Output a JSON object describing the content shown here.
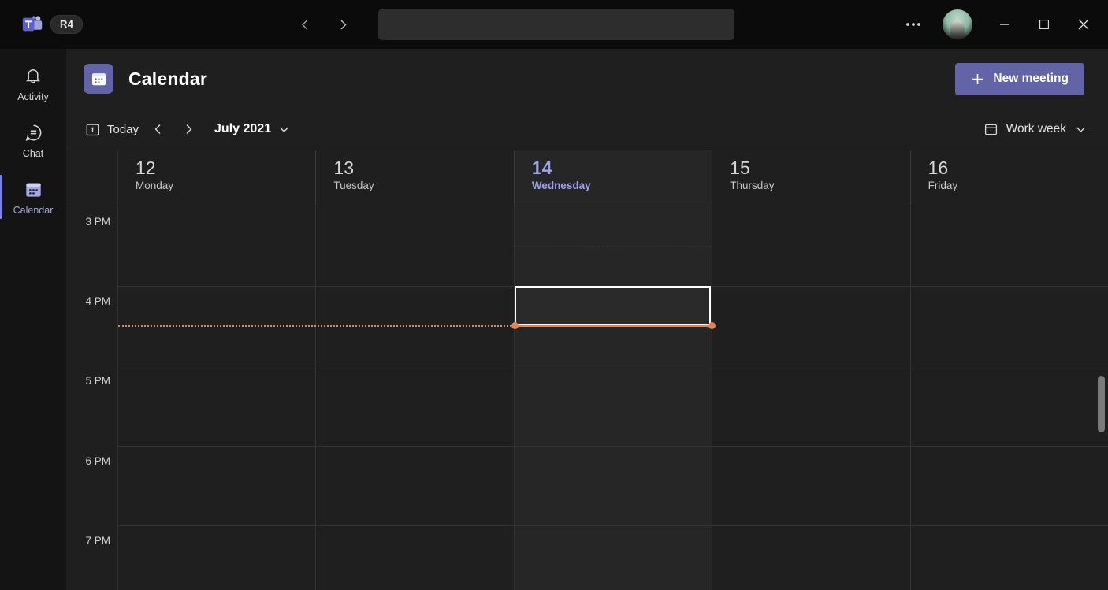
{
  "titlebar": {
    "app_badge": "R4",
    "logo_icon": "teams-logo",
    "back_icon": "chevron-left-icon",
    "forward_icon": "chevron-right-icon",
    "search_value": "",
    "search_placeholder": "",
    "more_icon": "ellipsis-icon",
    "avatar_icon": "user-avatar",
    "minimize_icon": "minimize-icon",
    "maximize_icon": "maximize-icon",
    "close_icon": "close-icon"
  },
  "rail": {
    "items": [
      {
        "label": "Activity",
        "icon": "bell-icon",
        "active": false
      },
      {
        "label": "Chat",
        "icon": "chat-bubble-icon",
        "active": false
      },
      {
        "label": "Calendar",
        "icon": "calendar-icon",
        "active": true
      }
    ]
  },
  "header": {
    "title": "Calendar",
    "app_icon": "calendar-icon",
    "new_meeting_label": "New meeting",
    "new_meeting_icon": "plus-icon"
  },
  "toolbar": {
    "today_label": "Today",
    "today_icon": "calendar-today-icon",
    "prev_icon": "chevron-left-icon",
    "next_icon": "chevron-right-icon",
    "period_label": "July 2021",
    "period_chevron_icon": "chevron-down-icon",
    "view_label": "Work week",
    "view_icon": "view-layout-icon",
    "view_chevron_icon": "chevron-down-icon"
  },
  "colors": {
    "accent": "#6264a7",
    "today_text": "#9ea2e8",
    "current_time": "#e3835a",
    "selection_border": "#ffffff",
    "window_bg": "#1f1f1f",
    "titlebar_bg": "#0b0b0b",
    "rail_bg": "#141414"
  },
  "calendar": {
    "days": [
      {
        "num": "12",
        "name": "Monday",
        "today": false
      },
      {
        "num": "13",
        "name": "Tuesday",
        "today": false
      },
      {
        "num": "14",
        "name": "Wednesday",
        "today": true
      },
      {
        "num": "15",
        "name": "Thursday",
        "today": false
      },
      {
        "num": "16",
        "name": "Friday",
        "today": false
      }
    ],
    "hours": [
      "3 PM",
      "4 PM",
      "5 PM",
      "6 PM",
      "7 PM"
    ],
    "current_time_row": "4 PM",
    "selection": {
      "day": "Wednesday",
      "start": "4 PM",
      "duration_label": "30 minutes"
    }
  }
}
